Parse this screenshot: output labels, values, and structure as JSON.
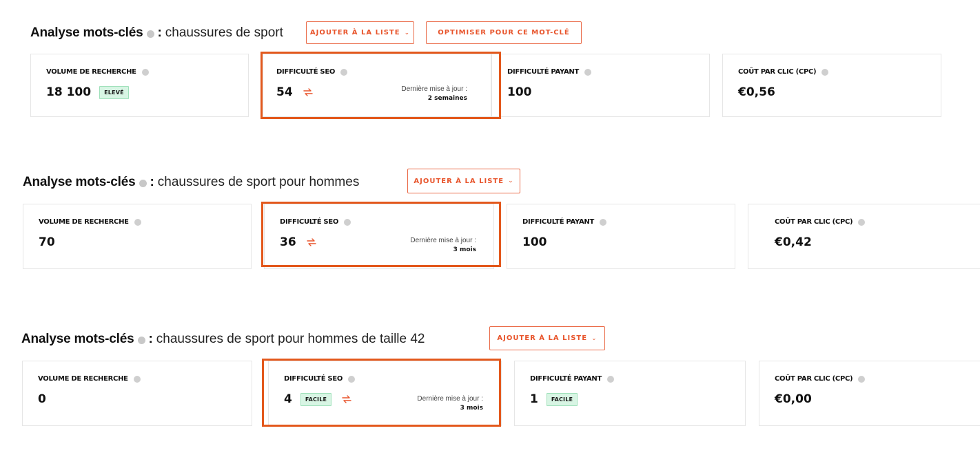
{
  "colors": {
    "accent": "#e8542b",
    "highlight": "#e3581c",
    "badge_bg": "#d8f5e4"
  },
  "sections": [
    {
      "title": "Analyse mots-clés",
      "colon": ":",
      "keyword": "chaussures de sport",
      "add_button": "AJOUTER À LA LISTE",
      "optimize_button": "OPTIMISER POUR CE MOT-CLÉ",
      "volume": {
        "label": "VOLUME DE RECHERCHE",
        "value": "18 100",
        "badge": "ELEVÉ"
      },
      "seo": {
        "label": "DIFFICULTÉ SEO",
        "value": "54",
        "updated_label": "Dernière mise à jour :",
        "updated_value": "2 semaines"
      },
      "paid": {
        "label": "DIFFICULTÉ PAYANT",
        "value": "100"
      },
      "cpc": {
        "label": "COÛT PAR CLIC (CPC)",
        "value": "€0,56"
      }
    },
    {
      "title": "Analyse mots-clés",
      "colon": ":",
      "keyword": "chaussures de sport pour hommes",
      "add_button": "AJOUTER À LA LISTE",
      "volume": {
        "label": "VOLUME DE RECHERCHE",
        "value": "70"
      },
      "seo": {
        "label": "DIFFICULTÉ SEO",
        "value": "36",
        "updated_label": "Dernière mise à jour :",
        "updated_value": "3 mois"
      },
      "paid": {
        "label": "DIFFICULTÉ PAYANT",
        "value": "100"
      },
      "cpc": {
        "label": "COÛT PAR CLIC (CPC)",
        "value": "€0,42"
      }
    },
    {
      "title": "Analyse mots-clés",
      "colon": ":",
      "keyword": "chaussures de sport pour hommes de taille 42",
      "add_button": "AJOUTER À LA LISTE",
      "volume": {
        "label": "VOLUME DE RECHERCHE",
        "value": "0"
      },
      "seo": {
        "label": "DIFFICULTÉ SEO",
        "value": "4",
        "badge": "FACILE",
        "updated_label": "Dernière mise à jour :",
        "updated_value": "3 mois"
      },
      "paid": {
        "label": "DIFFICULTÉ PAYANT",
        "value": "1",
        "badge": "FACILE"
      },
      "cpc": {
        "label": "COÛT PAR CLIC (CPC)",
        "value": "€0,00"
      }
    }
  ]
}
